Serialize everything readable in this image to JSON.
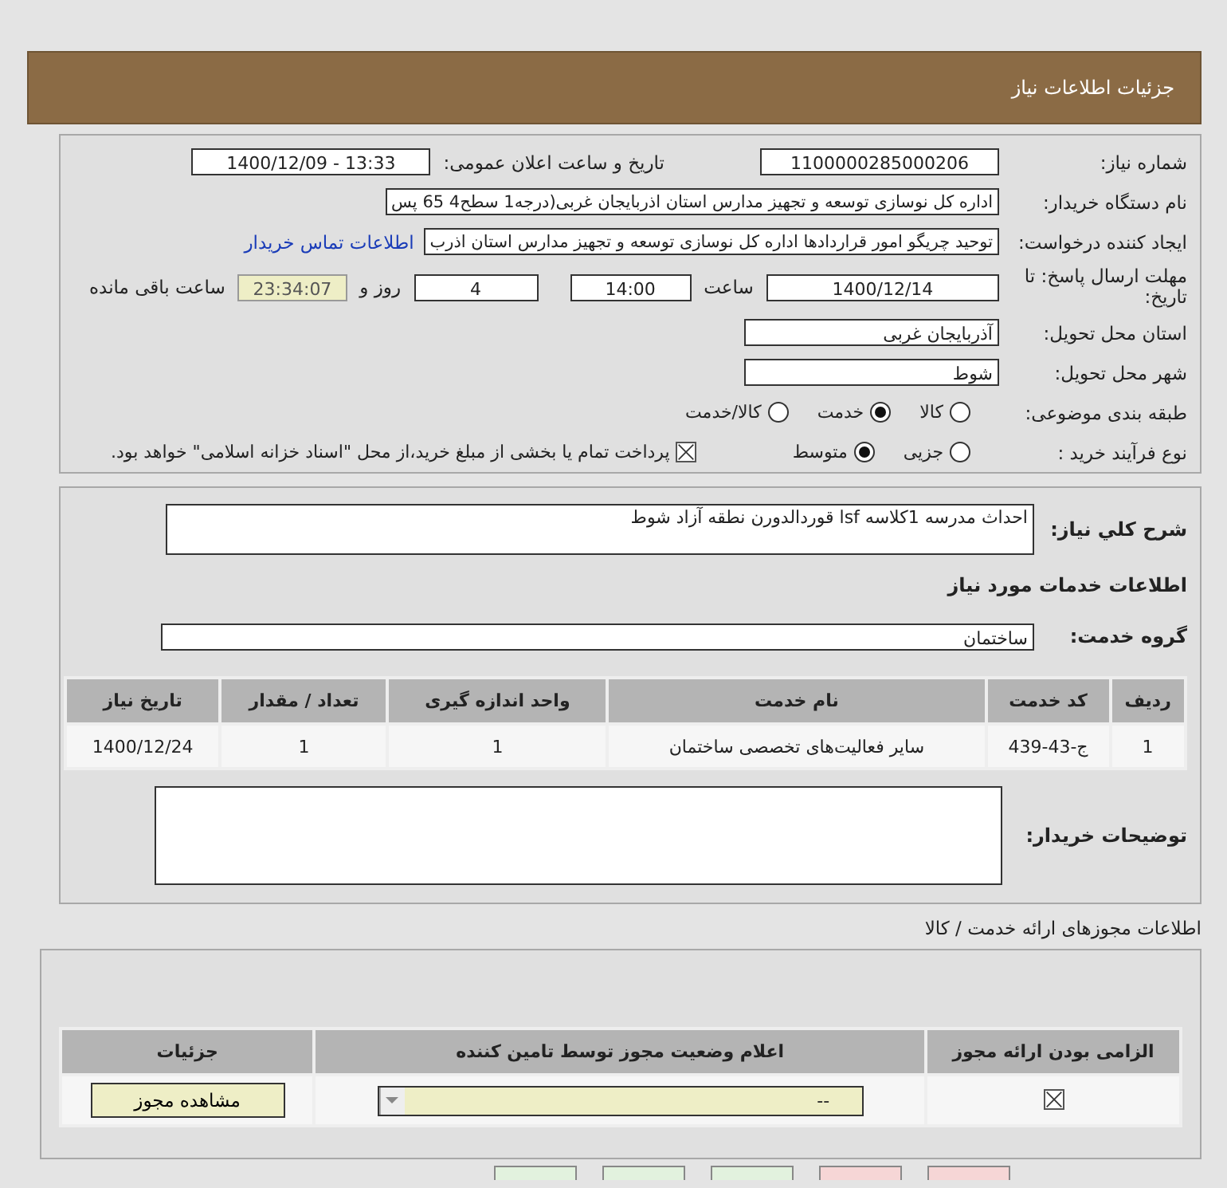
{
  "header": {
    "title": "جزئیات اطلاعات نیاز"
  },
  "details": {
    "need_number": {
      "label": "شماره نیاز:",
      "value": "1100000285000206"
    },
    "announce": {
      "label": "تاریخ و ساعت اعلان عمومی:",
      "value": "1400/12/09 - 13:33"
    },
    "buyer": {
      "label": "نام دستگاه خریدار:",
      "value": "اداره کل نوسازی   توسعه و تجهیز مدارس استان اذربایجان غربی(درجه1  سطح4  65 پس"
    },
    "creator": {
      "label": "ایجاد کننده درخواست:",
      "value": "توحید چریگو امور قراردادها اداره کل نوسازی   توسعه و تجهیز مدارس استان اذرب",
      "link": "اطلاعات تماس خریدار"
    },
    "deadline": {
      "label": "مهلت ارسال پاسخ: تا تاریخ:",
      "date": "1400/12/14",
      "time_label": "ساعت",
      "time": "14:00",
      "days": "4",
      "days_label": "روز و",
      "remaining": "23:34:07",
      "remaining_label": "ساعت باقی مانده"
    },
    "province": {
      "label": "استان محل تحویل:",
      "value": "آذربایجان غربی"
    },
    "city": {
      "label": "شهر محل تحویل:",
      "value": "شوط"
    },
    "category": {
      "label": "طبقه بندی موضوعی:",
      "options": [
        {
          "label": "کالا",
          "selected": false
        },
        {
          "label": "خدمت",
          "selected": true
        },
        {
          "label": "کالا/خدمت",
          "selected": false
        }
      ]
    },
    "process": {
      "label": "نوع فرآیند خرید :",
      "options": [
        {
          "label": "جزیی",
          "selected": false
        },
        {
          "label": "متوسط",
          "selected": true
        }
      ],
      "payment": {
        "checked": true,
        "text": "پرداخت تمام یا بخشی از مبلغ خرید،از محل \"اسناد خزانه اسلامی\" خواهد بود."
      }
    }
  },
  "services": {
    "summary_label": "شرح کلي نیاز:",
    "summary": "احداث مدرسه 1کلاسه lsf قوردالدورن نطقه آزاد شوط",
    "section_title": "اطلاعات خدمات مورد نیاز",
    "group_label": "گروه خدمت:",
    "group": "ساختمان",
    "table": {
      "columns": [
        "ردیف",
        "کد خدمت",
        "نام خدمت",
        "واحد اندازه گیری",
        "تعداد / مقدار",
        "تاریخ نیاز"
      ],
      "rows": [
        [
          "1",
          "ج-43-439",
          "سایر فعالیت‌های تخصصی ساختمان",
          "1",
          "1",
          "1400/12/24"
        ]
      ]
    },
    "notes_label": "توضیحات خریدار:"
  },
  "licenses": {
    "title": "اطلاعات مجوزهای ارائه خدمت / کالا",
    "columns": [
      "الزامی بودن ارائه مجوز",
      "اعلام وضعیت مجوز توسط تامین کننده",
      "جزئیات"
    ],
    "rows": [
      {
        "required": true,
        "status": "--",
        "button": "مشاهده مجوز"
      }
    ]
  },
  "bottom_buttons": [
    {
      "color": "#f6d6d6"
    },
    {
      "color": "#f6d6d6"
    },
    {
      "color": "#e2f2de"
    },
    {
      "color": "#e2f2de"
    },
    {
      "color": "#e2f2de"
    }
  ]
}
